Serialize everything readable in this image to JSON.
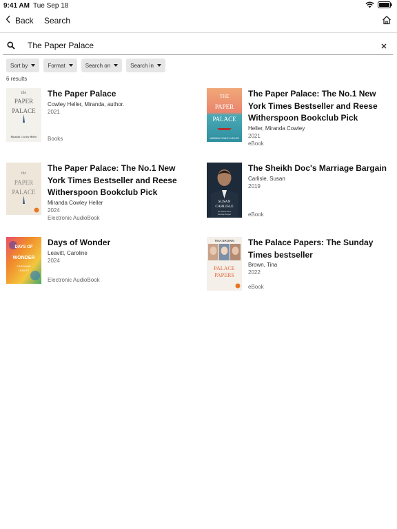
{
  "status_bar": {
    "time": "9:41 AM",
    "date": "Tue Sep 18"
  },
  "nav": {
    "back_label": "Back",
    "title": "Search"
  },
  "search": {
    "query": "The Paper Palace",
    "placeholder": ""
  },
  "filters": [
    "Sort by",
    "Format",
    "Search on",
    "Search in"
  ],
  "results_count": "6 results",
  "results": [
    {
      "title": "The Paper Palace",
      "lines": [
        "Cowley Heller, Miranda, author.",
        "2021"
      ],
      "format": "Books",
      "cover": {
        "top_text": "the",
        "main_text": "PAPER PALACE",
        "author_text": "Miranda Cowley Heller"
      }
    },
    {
      "title": "The Paper Palace: The No.1 New York Times Bestseller and Reese Witherspoon Bookclub Pick",
      "lines": [
        "Heller, Miranda Cowley",
        "2021"
      ],
      "format": "eBook",
      "cover": {
        "top_text": "THE",
        "main_text": "PAPER PALACE",
        "author_text": "MIRANDA COWLEY HELLER"
      }
    },
    {
      "title": "The Paper Palace: The No.1 New York Times Bestseller and Reese Witherspoon Bookclub Pick",
      "lines": [
        "Miranda Cowley Heller",
        "2024"
      ],
      "format": "Electronic AudioBook",
      "cover": {
        "top_text": "the",
        "main_text": "PAPER PALACE",
        "author_text": ""
      }
    },
    {
      "title": "The Sheikh Doc's Marriage Bargain",
      "lines": [
        "Carlisle, Susan",
        "2019"
      ],
      "format": "eBook",
      "cover": {
        "top_text": "",
        "main_text": "SUSAN CARLISLE",
        "author_text": "The Sheikh Doc's Marriage Bargain"
      }
    },
    {
      "title": "Days of Wonder",
      "lines": [
        "Leavitt, Caroline",
        "2024"
      ],
      "format": "Electronic AudioBook",
      "cover": {
        "top_text": "DAYS OF",
        "main_text": "WONDER",
        "author_text": "CAROLINE LEAVITT"
      }
    },
    {
      "title": "The Palace Papers: The Sunday Times bestseller",
      "lines": [
        "Brown, Tina",
        "2022"
      ],
      "format": "eBook",
      "cover": {
        "top_text": "TINA BROWN",
        "main_text": "PALACE PAPERS",
        "author_text": ""
      }
    }
  ]
}
